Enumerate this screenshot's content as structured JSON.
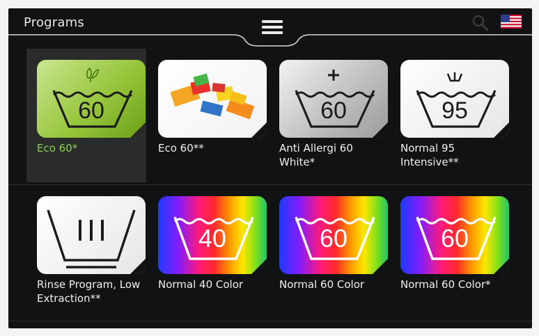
{
  "header": {
    "title": "Programs"
  },
  "colors": {
    "screen_bg": "#111214",
    "selected_label": "#8ed24d",
    "label": "#f0f0f0"
  },
  "programs": [
    {
      "label": "Eco 60*",
      "temp": "60",
      "selected": true,
      "icon": "eco-60-leaf-icon"
    },
    {
      "label": "Eco 60**",
      "temp": "",
      "selected": false,
      "icon": "lego-bricks-image"
    },
    {
      "label": "Anti Allergi 60 White*",
      "temp": "60",
      "selected": false,
      "icon": "anti-allergy-plus-icon"
    },
    {
      "label": "Normal 95 Intensive**",
      "temp": "95",
      "selected": false,
      "icon": "intensive-95-icon"
    },
    {
      "label": "Rinse Program, Low Extraction**",
      "temp": "",
      "selected": false,
      "icon": "rinse-icon"
    },
    {
      "label": "Normal 40 Color",
      "temp": "40",
      "selected": false,
      "icon": "color-40-icon"
    },
    {
      "label": "Normal 60 Color",
      "temp": "60",
      "selected": false,
      "icon": "color-60-icon"
    },
    {
      "label": "Normal 60 Color*",
      "temp": "60",
      "selected": false,
      "icon": "color-60-star-icon"
    }
  ]
}
